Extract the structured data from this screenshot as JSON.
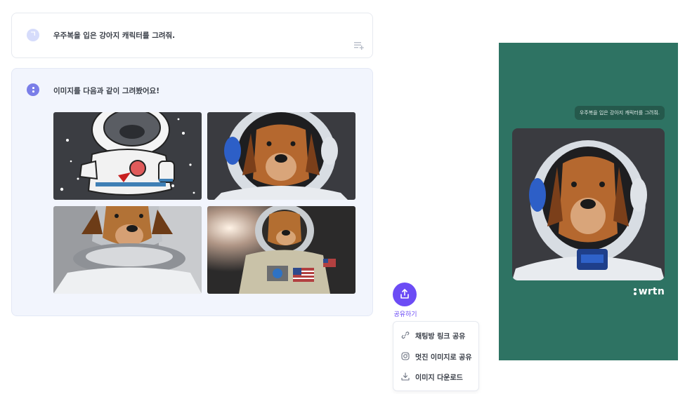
{
  "chat": {
    "user_avatar_initial": "ㄱ",
    "user_message": "우주복을 입은 강아지 캐릭터를 그려줘.",
    "bot_message": "이미지를 다음과 같이 그려봤어요!",
    "images": [
      {
        "name": "cartoon-astronaut-dog"
      },
      {
        "name": "astronaut-dog-helmet"
      },
      {
        "name": "astronaut-dog-collar"
      },
      {
        "name": "astronaut-dog-flag-suit"
      }
    ]
  },
  "share": {
    "button_label": "공유하기",
    "menu": [
      {
        "label": "채팅방 링크 공유",
        "icon": "link-icon"
      },
      {
        "label": "멋진 이미지로 공유",
        "icon": "instagram-icon"
      },
      {
        "label": "이미지 다운로드",
        "icon": "download-icon"
      }
    ]
  },
  "preview": {
    "bubble_text": "우주복을 입은 강아지 캐릭터를 그려줘.",
    "brand": "wrtn",
    "background_color": "#2e7363"
  },
  "colors": {
    "accent": "#6c4cf5",
    "bot_card_bg": "#f2f5fd"
  }
}
